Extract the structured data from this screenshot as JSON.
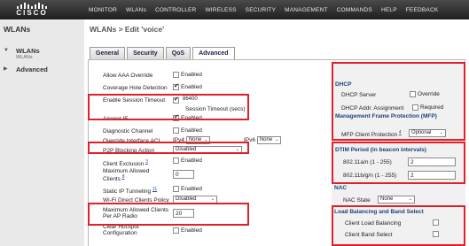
{
  "logo": {
    "text": "CISCO"
  },
  "top_nav": [
    "MONITOR",
    "WLANs",
    "CONTROLLER",
    "WIRELESS",
    "SECURITY",
    "MANAGEMENT",
    "COMMANDS",
    "HELP",
    "FEEDBACK"
  ],
  "sidebar": {
    "title": "WLANs",
    "items": [
      {
        "label": "WLANs",
        "sublabel": "WLANs"
      },
      {
        "label": "Advanced"
      }
    ]
  },
  "page_title": "WLANs > Edit  'voice'",
  "tabs": [
    "General",
    "Security",
    "QoS",
    "Advanced"
  ],
  "left_form": {
    "allow_aaa": {
      "label": "Allow AAA Override",
      "value": "Enabled"
    },
    "coverage_hole": {
      "label": "Coverage Hole Detection",
      "value": "Enabled"
    },
    "session_timeout": {
      "label": "Enable Session Timeout",
      "value": "86400",
      "note": "Session Timeout (secs)"
    },
    "aironet_ie": {
      "label": "Aironet IE",
      "value": "Enabled"
    },
    "diag_channel": {
      "label": "Diagnostic Channel",
      "value": "Enabled"
    },
    "override_acl": {
      "label": "Override Interface ACL",
      "ipv4_label": "IPv4",
      "ipv4_value": "None",
      "ipv6_label": "IPv6",
      "ipv6_value": "None"
    },
    "p2p": {
      "label": "P2P Blocking Action",
      "value": "Disabled"
    },
    "client_exclusion": {
      "label": "Client Exclusion",
      "sup": "3",
      "value": "Enabled"
    },
    "max_clients": {
      "label": "Maximum Allowed Clients",
      "sup": "8",
      "value": "0"
    },
    "static_ip": {
      "label": "Static IP Tunneling",
      "sup": "11",
      "value": "Enabled"
    },
    "wifi_direct": {
      "label": "Wi-Fi Direct Clients Policy",
      "value": "Disabled"
    },
    "max_per_ap": {
      "label": "Maximum Allowed Clients Per AP Radio",
      "value": "20"
    },
    "clear_hotspot": {
      "label": "Clear HotSpot Configuration",
      "value": "Enabled"
    }
  },
  "right_form": {
    "dhcp": {
      "title": "DHCP",
      "server_label": "DHCP Server",
      "override_label": "Override",
      "addr_label": "DHCP Addr. Assignment",
      "required_label": "Required"
    },
    "mfp": {
      "title": "Management Frame Protection (MFP)",
      "label": "MFP Client Protection",
      "sup": "4",
      "value": "Optional"
    },
    "dtim": {
      "title": "DTIM Period (in beacon intervals)",
      "a_label": "802.11a/n (1 - 255)",
      "a_value": "2",
      "b_label": "802.11b/g/n (1 - 255)",
      "b_value": "2"
    },
    "nac": {
      "title": "NAC",
      "state_label": "NAC State",
      "state_value": "None"
    },
    "lb": {
      "title": "Load Balancing and Band Select",
      "lb_label": "Client Load Balancing",
      "bs_label": "Client Band Select"
    }
  },
  "colors": {
    "highlight": "#e0202a",
    "section_title": "#21407d"
  }
}
